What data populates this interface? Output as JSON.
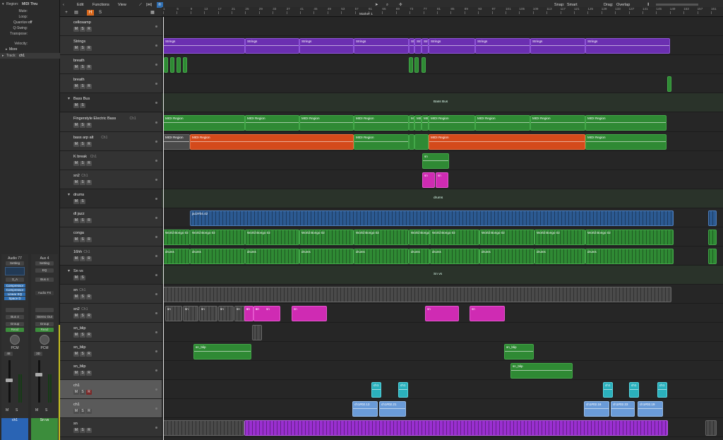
{
  "inspector": {
    "region_label": "Region:",
    "region_value": "MIDI Thru",
    "rows": [
      {
        "k": "Mute:",
        "v": ""
      },
      {
        "k": "Loop:",
        "v": ""
      },
      {
        "k": "Quantize",
        "v": "off"
      },
      {
        "k": "Q-Swing:",
        "v": ""
      },
      {
        "k": "Transpose:",
        "v": ""
      },
      {
        "k": "Velocity:",
        "v": ""
      }
    ],
    "more_label": "More",
    "track_label": "Track:",
    "track_value": "ch1",
    "strip_left": {
      "name": "Audio 77",
      "setting": "Setting",
      "eq": "EQ",
      "link": "3_A",
      "plugins": [
        "Compressor",
        "Compressor",
        "Linear EQ",
        "Space D"
      ],
      "bus": "Bus 4",
      "group": "Group",
      "mode": "Read",
      "pan_label": "PCM",
      "vol": "48",
      "ms": [
        "M",
        "S"
      ],
      "footer": "ch1",
      "footer_color": "#2a64b4"
    },
    "strip_right": {
      "name": "Aux 4",
      "setting": "Setting",
      "eq": "EQ",
      "link": "Bus 4",
      "plugins": [
        "Audio FX"
      ],
      "bus": "Stereo Out",
      "group": "Group",
      "mode": "Read",
      "pan_label": "PCM",
      "vol": "3D",
      "ms": [
        "M",
        "S"
      ],
      "footer": "Sn vs",
      "footer_color": "#3c8d3c"
    }
  },
  "toolbar": {
    "edit": "Edit",
    "functions": "Functions",
    "view": "View",
    "snap_label": "Snap:",
    "snap_value": "Smart",
    "drag_label": "Drag:",
    "drag_value": "Overlap",
    "btn_plus": "+",
    "btn_h": "H",
    "btn_s": "S"
  },
  "ruler": {
    "ticks": [
      "1",
      "5",
      "9",
      "13",
      "17",
      "21",
      "25",
      "29",
      "33",
      "37",
      "41",
      "45",
      "49",
      "53",
      "57",
      "61",
      "65",
      "69",
      "73",
      "77",
      "81",
      "85",
      "89",
      "93",
      "97",
      "101",
      "105",
      "109",
      "113",
      "117",
      "121",
      "125",
      "129",
      "133",
      "137",
      "141",
      "145",
      "149",
      "153",
      "157",
      "161"
    ],
    "marker": "Marker 1"
  },
  "tracks": [
    {
      "name": "cellosamp",
      "type": "track"
    },
    {
      "name": "Strings",
      "type": "track"
    },
    {
      "name": "breath",
      "type": "track"
    },
    {
      "name": "breath",
      "type": "track"
    },
    {
      "name": "Bass Bus",
      "type": "folder",
      "folder_label": "Bass Bus"
    },
    {
      "name": "Fingerstyle Electric Bass",
      "sub": "Ch1",
      "type": "track"
    },
    {
      "name": "bass arp alt",
      "sub": "Ch1",
      "type": "track"
    },
    {
      "name": "K break",
      "sub": "Ch1",
      "type": "track"
    },
    {
      "name": "sn2",
      "sub": "Ch1",
      "type": "track"
    },
    {
      "name": "drums",
      "type": "folder",
      "folder_label": "drums"
    },
    {
      "name": "dl jazz",
      "type": "track"
    },
    {
      "name": "conga",
      "type": "track"
    },
    {
      "name": "16hh",
      "sub": "Ch1",
      "type": "track"
    },
    {
      "name": "Sn vs",
      "type": "folder",
      "folder_label": "Sn vs"
    },
    {
      "name": "sn",
      "sub": "Ch1",
      "type": "track"
    },
    {
      "name": "sn2",
      "sub": "Ch1",
      "type": "track"
    },
    {
      "name": "sn_blip",
      "type": "track"
    },
    {
      "name": "sn_blip",
      "type": "track"
    },
    {
      "name": "sn_blip",
      "type": "track"
    },
    {
      "name": "ch1",
      "type": "track",
      "selected": true,
      "rec": true
    },
    {
      "name": "ch1",
      "type": "track",
      "selected": true
    },
    {
      "name": "sn",
      "type": "track"
    }
  ],
  "msr": [
    "M",
    "S",
    "R"
  ],
  "regions": {
    "strings": "Strings",
    "midi": "MIDI Region",
    "jazz": "jazz#04.42",
    "bongo": "World Bongo 02",
    "drums": "drums",
    "sn": "sn",
    "sn_blip": "sn_blip",
    "ch1_a": "ch1",
    "ch1_b": "ch1#02.13",
    "ch1_c": "ch1#02.21",
    "ch1_d": "ch1#02.16",
    "ch1_e": "ch1#02.23",
    "ch1_f": "ch1#02.19"
  },
  "colors": {
    "purple": "#6b2fb1",
    "green": "#2f8a34",
    "orange": "#d44a1b",
    "blue": "#2c5a92",
    "magenta": "#cf2bb3",
    "cyan": "#2bb1bd",
    "violet": "#9a2fd0"
  }
}
